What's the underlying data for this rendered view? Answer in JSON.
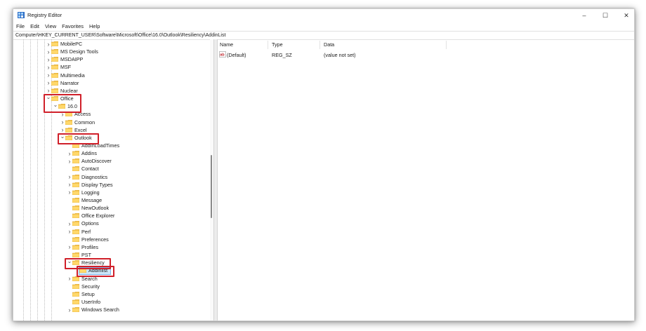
{
  "window": {
    "title": "Registry Editor",
    "controls": {
      "minimize": "–",
      "maximize": "☐",
      "close": "✕"
    }
  },
  "menu": [
    "File",
    "Edit",
    "View",
    "Favorites",
    "Help"
  ],
  "address": "Computer\\HKEY_CURRENT_USER\\Software\\Microsoft\\Office\\16.0\\Outlook\\Resiliency\\AddinList",
  "tree": [
    {
      "label": "MobilePC",
      "level": 0,
      "expander": "collapsed"
    },
    {
      "label": "MS Design Tools",
      "level": 0,
      "expander": "collapsed"
    },
    {
      "label": "MSDAIPP",
      "level": 0,
      "expander": "collapsed"
    },
    {
      "label": "MSF",
      "level": 0,
      "expander": "collapsed"
    },
    {
      "label": "Multimedia",
      "level": 0,
      "expander": "collapsed"
    },
    {
      "label": "Narrator",
      "level": 0,
      "expander": "collapsed"
    },
    {
      "label": "Nuclear",
      "level": 0,
      "expander": "collapsed"
    },
    {
      "label": "Office",
      "level": 0,
      "expander": "expanded"
    },
    {
      "label": "16.0",
      "level": 1,
      "expander": "expanded"
    },
    {
      "label": "Access",
      "level": 2,
      "expander": "collapsed"
    },
    {
      "label": "Common",
      "level": 2,
      "expander": "collapsed"
    },
    {
      "label": "Excel",
      "level": 2,
      "expander": "collapsed"
    },
    {
      "label": "Outlook",
      "level": 2,
      "expander": "expanded"
    },
    {
      "label": "AddInLoadTimes",
      "level": 3,
      "expander": "none"
    },
    {
      "label": "Addins",
      "level": 3,
      "expander": "collapsed"
    },
    {
      "label": "AutoDiscover",
      "level": 3,
      "expander": "collapsed"
    },
    {
      "label": "Contact",
      "level": 3,
      "expander": "none"
    },
    {
      "label": "Diagnostics",
      "level": 3,
      "expander": "collapsed"
    },
    {
      "label": "Display Types",
      "level": 3,
      "expander": "collapsed"
    },
    {
      "label": "Logging",
      "level": 3,
      "expander": "collapsed"
    },
    {
      "label": "Message",
      "level": 3,
      "expander": "none"
    },
    {
      "label": "NewOutlook",
      "level": 3,
      "expander": "none"
    },
    {
      "label": "Office Explorer",
      "level": 3,
      "expander": "none"
    },
    {
      "label": "Options",
      "level": 3,
      "expander": "collapsed"
    },
    {
      "label": "Perf",
      "level": 3,
      "expander": "collapsed"
    },
    {
      "label": "Preferences",
      "level": 3,
      "expander": "none"
    },
    {
      "label": "Profiles",
      "level": 3,
      "expander": "collapsed"
    },
    {
      "label": "PST",
      "level": 3,
      "expander": "none"
    },
    {
      "label": "Resiliency",
      "level": 3,
      "expander": "expanded"
    },
    {
      "label": "Addinlist",
      "level": 4,
      "expander": "none",
      "selected": true
    },
    {
      "label": "Search",
      "level": 3,
      "expander": "collapsed"
    },
    {
      "label": "Security",
      "level": 3,
      "expander": "none"
    },
    {
      "label": "Setup",
      "level": 3,
      "expander": "none"
    },
    {
      "label": "UserInfo",
      "level": 3,
      "expander": "none"
    },
    {
      "label": "Windows Search",
      "level": 3,
      "expander": "collapsed"
    }
  ],
  "list": {
    "columns": [
      "Name",
      "Type",
      "Data"
    ],
    "rows": [
      {
        "icon": "string-value-icon",
        "name": "(Default)",
        "type": "REG_SZ",
        "data": "(value not set)"
      }
    ]
  },
  "colors": {
    "highlight_box": "#d0202a",
    "folder": "#f2c14e",
    "selection": "#cde6f7"
  }
}
